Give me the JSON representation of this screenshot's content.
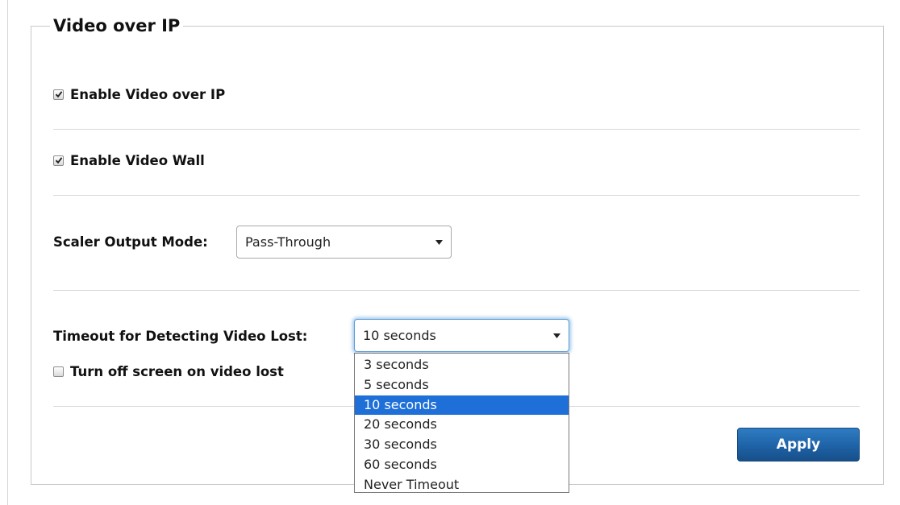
{
  "section": {
    "title": "Video over IP"
  },
  "enable_video_over_ip": {
    "label": "Enable Video over IP",
    "checked": true
  },
  "enable_video_wall": {
    "label": "Enable Video Wall",
    "checked": true
  },
  "scaler_output_mode": {
    "label": "Scaler Output Mode:",
    "value": "Pass-Through"
  },
  "timeout": {
    "label": "Timeout for Detecting Video Lost:",
    "value": "10 seconds",
    "options": [
      "3 seconds",
      "5 seconds",
      "10 seconds",
      "20 seconds",
      "30 seconds",
      "60 seconds",
      "Never Timeout"
    ],
    "highlighted_option": "10 seconds"
  },
  "turn_off_screen": {
    "label": "Turn off screen on video lost",
    "checked": false
  },
  "apply_button": {
    "label": "Apply"
  },
  "colors": {
    "accent": "#1e6fd8",
    "button": "#1e62a6",
    "focus_ring": "#5b9dd9"
  }
}
